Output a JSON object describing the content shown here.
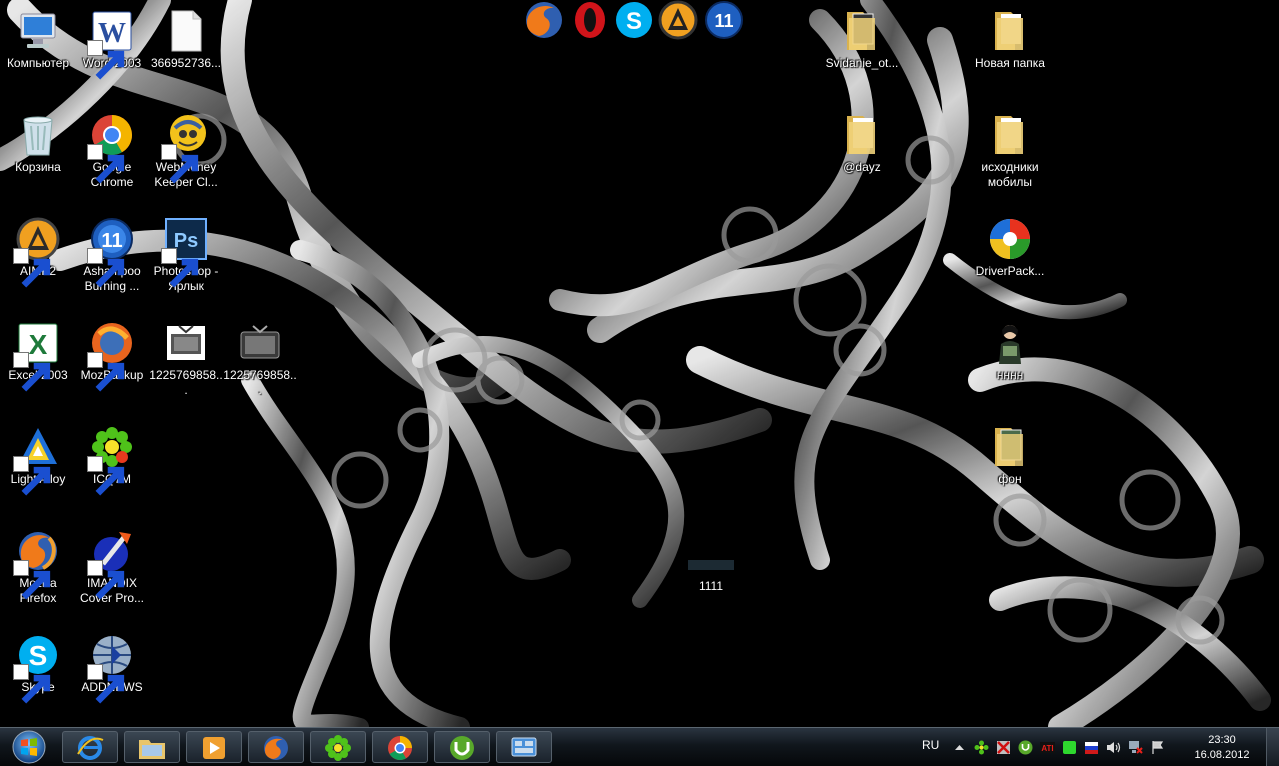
{
  "desktop": {
    "left_icons": [
      {
        "label": "Компьютер",
        "icon": "computer-icon",
        "shortcut": false
      },
      {
        "label": "Word 2003",
        "icon": "word-icon",
        "shortcut": true
      },
      {
        "label": "366952736...",
        "icon": "blank-file-icon",
        "shortcut": false
      },
      {
        "label": "Корзина",
        "icon": "recycle-bin-icon",
        "shortcut": false
      },
      {
        "label": "Google\nChrome",
        "icon": "chrome-icon",
        "shortcut": true
      },
      {
        "label": "WebMoney\nKeeper Cl...",
        "icon": "webmoney-icon",
        "shortcut": true
      },
      {
        "label": "AIMP2",
        "icon": "aimp-icon",
        "shortcut": true
      },
      {
        "label": "Ashampoo\nBurning ...",
        "icon": "ashampoo-icon",
        "shortcut": true
      },
      {
        "label": "Photoshop -\nЯрлык",
        "icon": "photoshop-icon",
        "shortcut": true
      },
      {
        "label": "Excel 2003",
        "icon": "excel-icon",
        "shortcut": true
      },
      {
        "label": "MozBackup",
        "icon": "mozbackup-icon",
        "shortcut": true
      },
      {
        "label": "1225769858...",
        "icon": "tv-icon",
        "shortcut": false
      },
      {
        "label": "1225769858...",
        "icon": "tv-icon",
        "shortcut": false
      },
      {
        "label": "Light Alloy",
        "icon": "light-alloy-icon",
        "shortcut": true
      },
      {
        "label": "ICQ7M",
        "icon": "icq-icon",
        "shortcut": true
      },
      {
        "label": "Mozilla\nFirefox",
        "icon": "firefox-icon",
        "shortcut": true
      },
      {
        "label": "IMANDIX\nCover Pro...",
        "icon": "imandix-icon",
        "shortcut": true
      },
      {
        "label": "Skype",
        "icon": "skype-icon",
        "shortcut": true
      },
      {
        "label": "ADDNEWS",
        "icon": "addnews-icon",
        "shortcut": true
      }
    ],
    "right_icons": [
      {
        "label": "Svidanie_ot...",
        "icon": "folder-icon"
      },
      {
        "label": "Новая папка",
        "icon": "folder-icon"
      },
      {
        "label": "@dayz",
        "icon": "folder-icon"
      },
      {
        "label": "исходники\nмобилы",
        "icon": "folder-icon"
      },
      {
        "label": "DriverPack...",
        "icon": "driverpack-icon"
      },
      {
        "label": "нннн",
        "icon": "person-image-icon"
      },
      {
        "label": "фон",
        "icon": "folder-icon"
      }
    ],
    "file_1111": {
      "label": "1111"
    }
  },
  "top_dock": [
    "firefox-icon",
    "opera-icon",
    "skype-icon",
    "aimp-icon",
    "ashampoo-icon"
  ],
  "taskbar": {
    "pinned": [
      "internet-explorer-icon",
      "explorer-folder-icon",
      "media-player-icon",
      "firefox-icon",
      "icq-icon",
      "chrome-icon",
      "utorrent-icon",
      "network-gadget-icon"
    ],
    "tray": {
      "language": "RU",
      "icons": [
        "show-hidden-icons-arrow",
        "icq-tray-icon",
        "antivirus-tray-icon",
        "utorrent-tray-icon",
        "ati-tray-icon",
        "green-status-icon",
        "flag-icon",
        "volume-icon",
        "network-off-icon",
        "action-center-icon"
      ],
      "time": "23:30",
      "date": "16.08.2012"
    }
  },
  "colors": {
    "desktop_bg": "#000000",
    "taskbar": "#10161c",
    "folder": "#e8c56b",
    "text": "#ffffff"
  }
}
